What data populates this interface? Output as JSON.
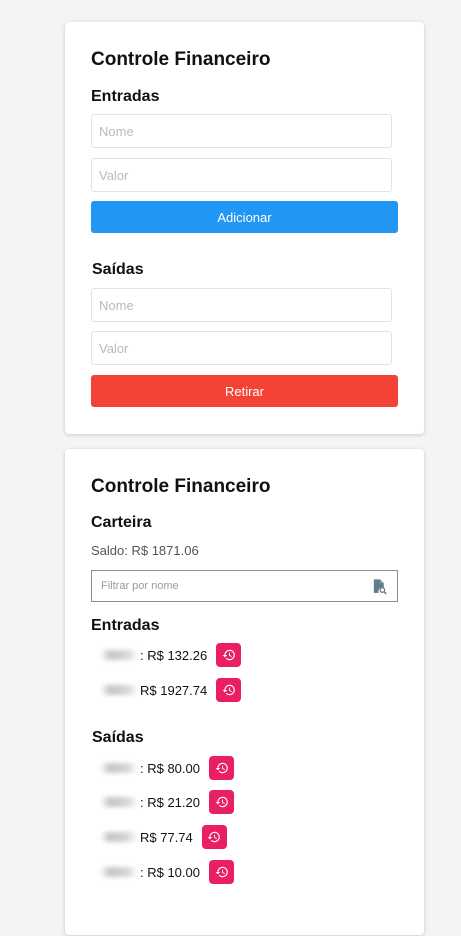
{
  "top_card": {
    "title": "Controle Financeiro",
    "entradas": {
      "heading": "Entradas",
      "name_placeholder": "Nome",
      "value_placeholder": "Valor",
      "button_label": "Adicionar"
    },
    "saidas": {
      "heading": "Saídas",
      "name_placeholder": "Nome",
      "value_placeholder": "Valor",
      "button_label": "Retirar"
    }
  },
  "bottom_card": {
    "title": "Controle Financeiro",
    "wallet_heading": "Carteira",
    "balance": "Saldo: R$ 1871.06",
    "filter_placeholder": "Filtrar por nome",
    "entradas_heading": "Entradas",
    "entradas": [
      {
        "amount": ": R$ 132.26"
      },
      {
        "amount": "R$ 1927.74"
      }
    ],
    "saidas_heading": "Saídas",
    "saidas": [
      {
        "amount": ": R$ 80.00"
      },
      {
        "amount": ": R$ 21.20"
      },
      {
        "amount": "R$ 77.74"
      },
      {
        "amount": ": R$ 10.00"
      }
    ]
  },
  "colors": {
    "add_button": "#2196f3",
    "withdraw_button": "#f44336",
    "history_button": "#e91e63"
  },
  "icons": {
    "filter": "file-search-icon",
    "history": "history-icon"
  }
}
